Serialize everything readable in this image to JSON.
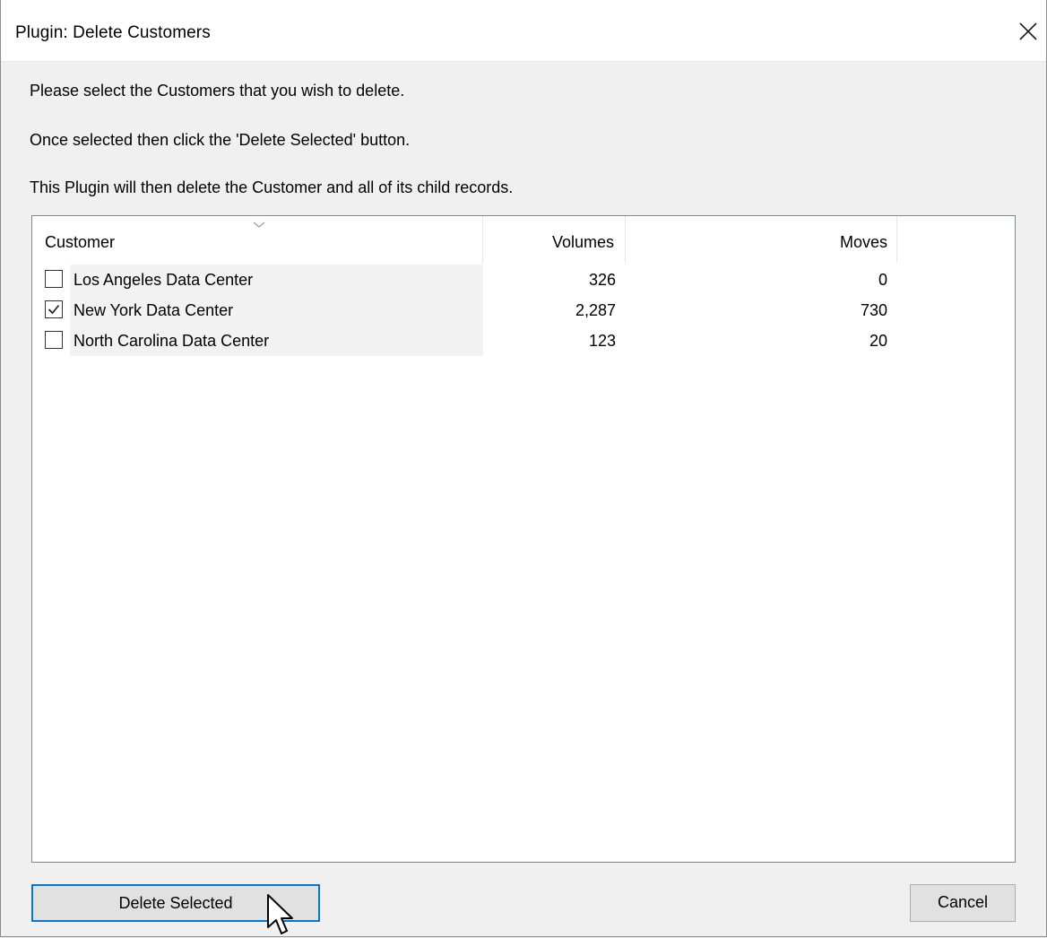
{
  "window": {
    "title": "Plugin: Delete Customers",
    "close_icon": "close-icon"
  },
  "messages": {
    "line1": "Please select the Customers that you wish to delete.",
    "line2": "Once selected then click the 'Delete Selected' button.",
    "line3": "This Plugin will then delete the Customer and all of its child records."
  },
  "table": {
    "sort_icon": "chevron-down-icon",
    "columns": {
      "customer": "Customer",
      "volumes": "Volumes",
      "moves": "Moves"
    },
    "rows": [
      {
        "name": "Los Angeles Data Center",
        "volumes": "326",
        "moves": "0",
        "checked": false
      },
      {
        "name": "New York Data Center",
        "volumes": "2,287",
        "moves": "730",
        "checked": true
      },
      {
        "name": "North Carolina Data Center",
        "volumes": "123",
        "moves": "20",
        "checked": false
      }
    ]
  },
  "buttons": {
    "delete_label": "Delete Selected",
    "cancel_label": "Cancel"
  },
  "colors": {
    "focus_border": "#0078d7",
    "button_face": "#e1e1e1",
    "dialog_bg": "#f0f0f0"
  }
}
